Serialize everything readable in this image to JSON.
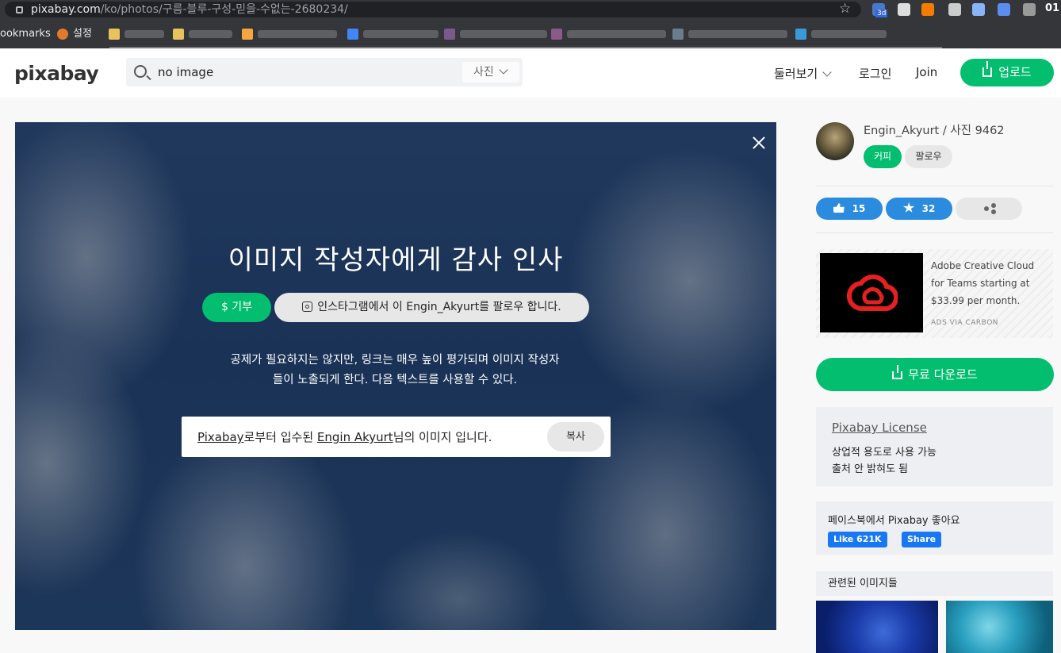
{
  "browser": {
    "url_host": "pixabay.com",
    "url_path": "/ko/photos/구름-블루-구성-믿을-수없는-2680234/",
    "ext_badge": "3d",
    "clipped_label": "01",
    "bookmarks": [
      {
        "label": "ookmarks"
      },
      {
        "label": "설정"
      }
    ]
  },
  "header": {
    "logo": "pixabay",
    "search_value": "no image",
    "search_type": "사진",
    "nav_explore": "둘러보기",
    "nav_login": "로그인",
    "nav_join": "Join",
    "upload_label": "업로드"
  },
  "hero": {
    "title": "이미지 작성자에게 감사 인사",
    "donate_label": "$ 기부",
    "instagram_label": "인스타그램에서 이 Engin_Akyurt를 팔로우 합니다.",
    "body": "공제가 필요하지는 않지만, 링크는 매우 높이 평가되며 이미지 작성자들이 노출되게 한다. 다음 텍스트를 사용할 수 있다.",
    "credit_link1": "Pixabay",
    "credit_mid": "로부터 입수된 ",
    "credit_link2": "Engin Akyurt",
    "credit_tail": "님의 이미지 입니다.",
    "copy_label": "복사"
  },
  "sidebar": {
    "author": "Engin_Akyurt / 사진 9462",
    "coffee_label": "커피",
    "follow_label": "팔로우",
    "likes": "15",
    "favorites": "32",
    "ad_text": "Adobe Creative Cloud for Teams starting at $33.99 per month.",
    "ad_via": "ADS VIA CARBON",
    "download_label": "무료 다운로드",
    "license_title": "Pixabay License",
    "license_line1": "상업적 용도로 사용 가능",
    "license_line2": "출처 안 밝혀도 됨",
    "fb_title": "페이스북에서 Pixabay 좋아요",
    "fb_like": "Like 621K",
    "fb_share": "Share",
    "related_title": "관련된 이미지들"
  },
  "colors": {
    "green": "#02be6e",
    "blue": "#2a8bdf",
    "facebook": "#1877f2"
  }
}
